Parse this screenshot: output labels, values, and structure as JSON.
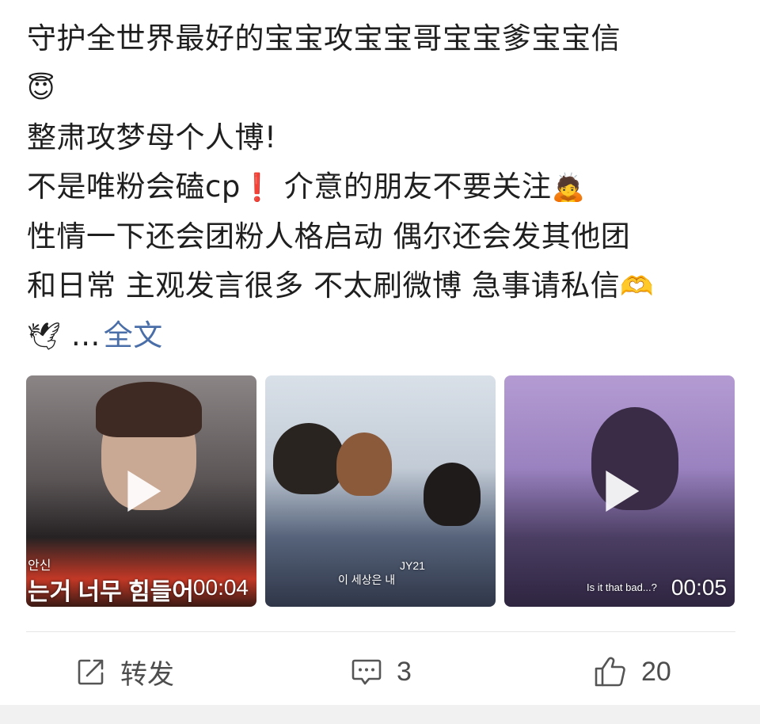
{
  "post": {
    "lines": [
      "守护全世界最好的宝宝攻宝宝哥宝宝爹宝宝信",
      "整肃攻梦母个人博!",
      "不是唯粉会磕cp",
      "介意的朋友不要关注",
      "性情一下还会团粉人格启动 偶尔还会发其他团",
      "和日常 主观发言很多 不太刷微博 急事请私信",
      "..."
    ],
    "emoji": {
      "halo": "😇",
      "exclamation": "❗",
      "bow": "🙇",
      "heart_hands": "🫶",
      "dove": "🕊"
    },
    "more_label": "全文"
  },
  "media": [
    {
      "duration": "00:04",
      "overlay_left": "안신",
      "overlay_bottom": "는거 너무 힘들어",
      "icon": "play-icon"
    },
    {
      "duration": "",
      "overlay_center": "이 세상은 내",
      "overlay_tag": "JY21",
      "icon": "play-icon"
    },
    {
      "duration": "00:05",
      "overlay_caption": "Is it that bad...?",
      "icon": "play-icon"
    }
  ],
  "actions": {
    "repost_label": "转发",
    "comment_count": "3",
    "like_count": "20"
  },
  "colors": {
    "link": "#4a6ea8",
    "text": "#1f1f1f",
    "action": "#4d4d4d"
  }
}
